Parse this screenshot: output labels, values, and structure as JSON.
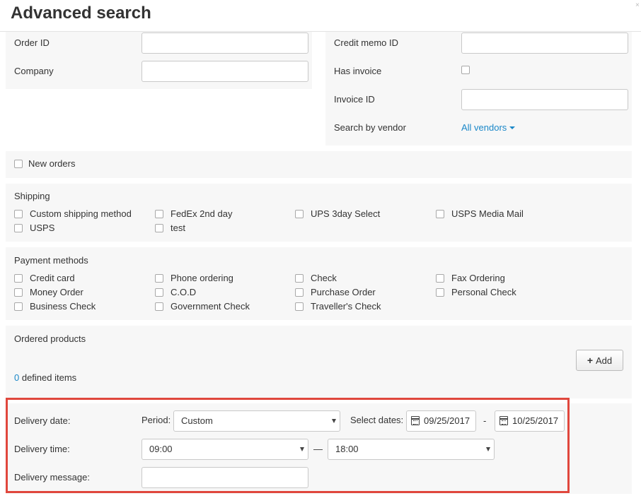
{
  "header": {
    "title": "Advanced search"
  },
  "left_panel": {
    "order_id_label": "Order ID",
    "company_label": "Company"
  },
  "right_panel": {
    "credit_memo_label": "Credit memo ID",
    "has_invoice_label": "Has invoice",
    "invoice_id_label": "Invoice ID",
    "vendor_label": "Search by vendor",
    "vendor_value": "All vendors"
  },
  "new_orders": {
    "label": "New orders"
  },
  "shipping": {
    "title": "Shipping",
    "options": [
      "Custom shipping method",
      "FedEx 2nd day",
      "UPS 3day Select",
      "USPS Media Mail",
      "USPS",
      "test"
    ]
  },
  "payment": {
    "title": "Payment methods",
    "options": [
      "Credit card",
      "Phone ordering",
      "Check",
      "Fax Ordering",
      "Money Order",
      "C.O.D",
      "Purchase Order",
      "Personal Check",
      "Business Check",
      "Government Check",
      "Traveller's Check"
    ]
  },
  "products": {
    "title": "Ordered products",
    "add_label": "Add",
    "count": "0",
    "count_suffix": " defined items"
  },
  "delivery": {
    "date_label": "Delivery date:",
    "period_label": "Period:",
    "period_value": "Custom",
    "select_dates_label": "Select dates:",
    "date_from": "09/25/2017",
    "date_sep": "-",
    "date_to": "10/25/2017",
    "time_label": "Delivery time:",
    "time_from": "09:00",
    "time_sep": "—",
    "time_to": "18:00",
    "message_label": "Delivery message:"
  }
}
